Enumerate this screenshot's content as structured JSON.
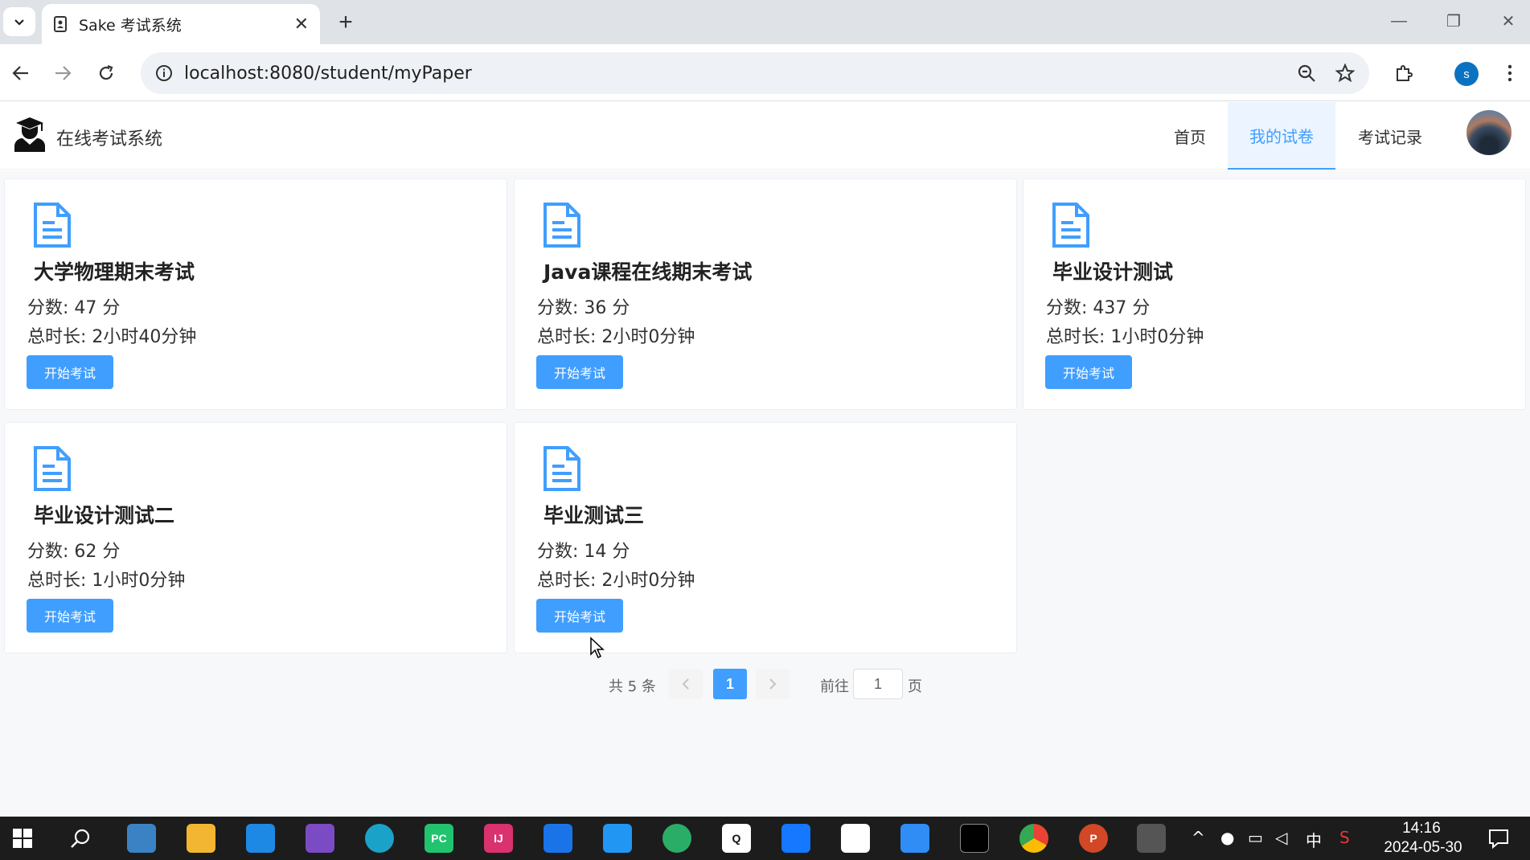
{
  "browser": {
    "tab_title": "Sake 考试系统",
    "url": "localhost:8080/student/myPaper",
    "profile_initial": "s"
  },
  "app": {
    "title": "在线考试系统",
    "nav": [
      "首页",
      "我的试卷",
      "考试记录"
    ],
    "active_nav": "我的试卷",
    "accent_color": "#409eff"
  },
  "papers": [
    {
      "title": "大学物理期末考试",
      "score": "分数: 47 分",
      "duration": "总时长: 2小时40分钟",
      "button": "开始考试"
    },
    {
      "title": "Java课程在线期末考试",
      "score": "分数: 36 分",
      "duration": "总时长: 2小时0分钟",
      "button": "开始考试"
    },
    {
      "title": "毕业设计测试",
      "score": "分数: 437 分",
      "duration": "总时长: 1小时0分钟",
      "button": "开始考试"
    },
    {
      "title": "毕业设计测试二",
      "score": "分数: 62 分",
      "duration": "总时长: 1小时0分钟",
      "button": "开始考试"
    },
    {
      "title": "毕业测试三",
      "score": "分数: 14 分",
      "duration": "总时长: 2小时0分钟",
      "button": "开始考试"
    }
  ],
  "pagination": {
    "total": "共 5 条",
    "current_page": "1",
    "goto_label": "前往",
    "goto_value": "1",
    "page_suffix": "页"
  },
  "taskbar": {
    "time": "14:16",
    "date": "2024-05-30",
    "ime": "中"
  }
}
